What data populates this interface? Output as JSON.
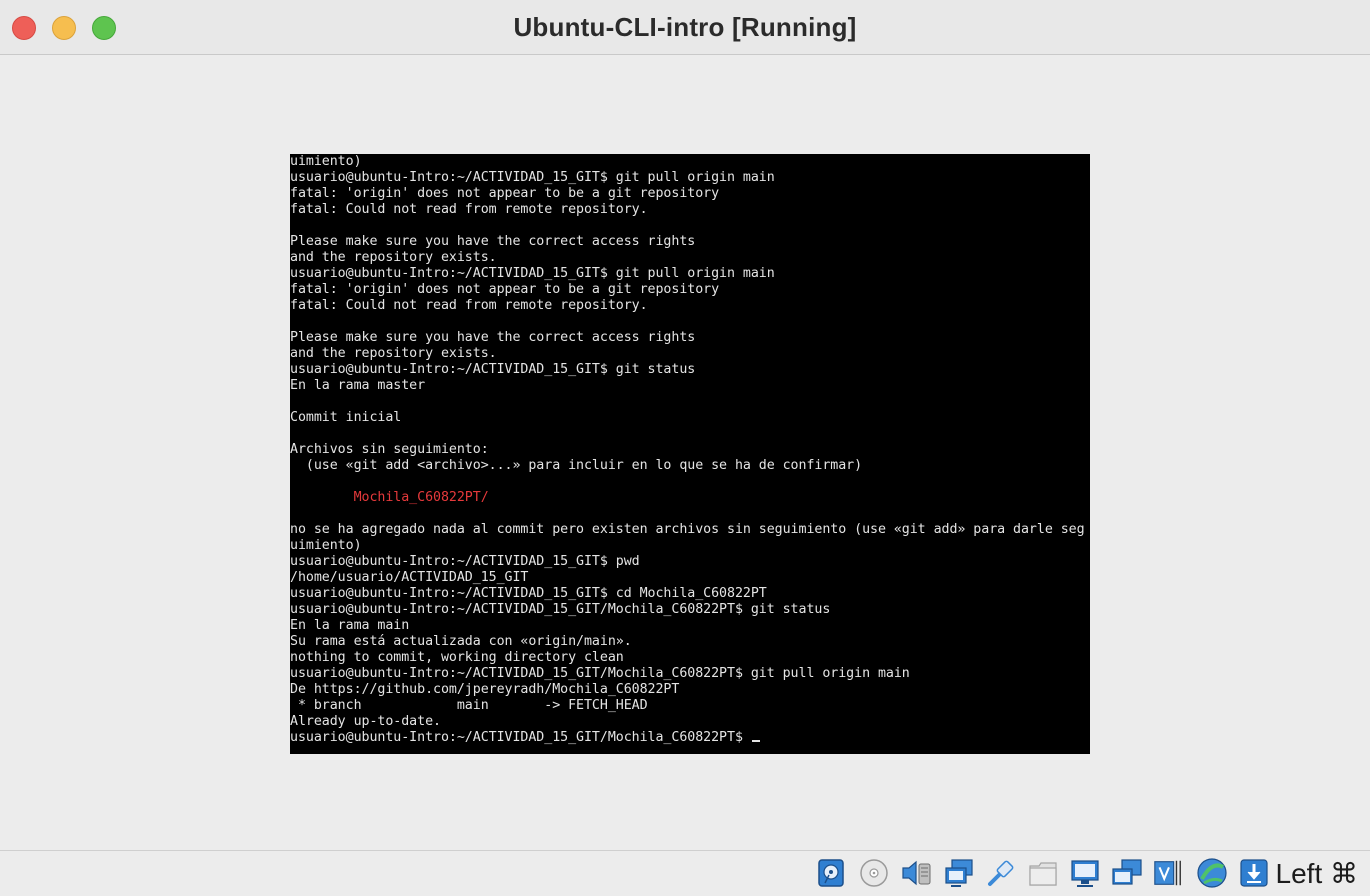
{
  "window": {
    "title": "Ubuntu-CLI-intro [Running]"
  },
  "terminal": {
    "lines": [
      {
        "text": "uimiento)",
        "color": "default"
      },
      {
        "text": "usuario@ubuntu-Intro:~/ACTIVIDAD_15_GIT$ git pull origin main",
        "color": "default"
      },
      {
        "text": "fatal: 'origin' does not appear to be a git repository",
        "color": "default"
      },
      {
        "text": "fatal: Could not read from remote repository.",
        "color": "default"
      },
      {
        "text": "",
        "color": "default"
      },
      {
        "text": "Please make sure you have the correct access rights",
        "color": "default"
      },
      {
        "text": "and the repository exists.",
        "color": "default"
      },
      {
        "text": "usuario@ubuntu-Intro:~/ACTIVIDAD_15_GIT$ git pull origin main",
        "color": "default"
      },
      {
        "text": "fatal: 'origin' does not appear to be a git repository",
        "color": "default"
      },
      {
        "text": "fatal: Could not read from remote repository.",
        "color": "default"
      },
      {
        "text": "",
        "color": "default"
      },
      {
        "text": "Please make sure you have the correct access rights",
        "color": "default"
      },
      {
        "text": "and the repository exists.",
        "color": "default"
      },
      {
        "text": "usuario@ubuntu-Intro:~/ACTIVIDAD_15_GIT$ git status",
        "color": "default"
      },
      {
        "text": "En la rama master",
        "color": "default"
      },
      {
        "text": "",
        "color": "default"
      },
      {
        "text": "Commit inicial",
        "color": "default"
      },
      {
        "text": "",
        "color": "default"
      },
      {
        "text": "Archivos sin seguimiento:",
        "color": "default"
      },
      {
        "text": "  (use «git add <archivo>...» para incluir en lo que se ha de confirmar)",
        "color": "default"
      },
      {
        "text": "",
        "color": "default"
      },
      {
        "text": "        Mochila_C60822PT/",
        "color": "red"
      },
      {
        "text": "",
        "color": "default"
      },
      {
        "text": "no se ha agregado nada al commit pero existen archivos sin seguimiento (use «git add» para darle seg",
        "color": "default"
      },
      {
        "text": "uimiento)",
        "color": "default"
      },
      {
        "text": "usuario@ubuntu-Intro:~/ACTIVIDAD_15_GIT$ pwd",
        "color": "default"
      },
      {
        "text": "/home/usuario/ACTIVIDAD_15_GIT",
        "color": "default"
      },
      {
        "text": "usuario@ubuntu-Intro:~/ACTIVIDAD_15_GIT$ cd Mochila_C60822PT",
        "color": "default"
      },
      {
        "text": "usuario@ubuntu-Intro:~/ACTIVIDAD_15_GIT/Mochila_C60822PT$ git status",
        "color": "default"
      },
      {
        "text": "En la rama main",
        "color": "default"
      },
      {
        "text": "Su rama está actualizada con «origin/main».",
        "color": "default"
      },
      {
        "text": "nothing to commit, working directory clean",
        "color": "default"
      },
      {
        "text": "usuario@ubuntu-Intro:~/ACTIVIDAD_15_GIT/Mochila_C60822PT$ git pull origin main",
        "color": "default"
      },
      {
        "text": "De https://github.com/jpereyradh/Mochila_C60822PT",
        "color": "default"
      },
      {
        "text": " * branch            main       -> FETCH_HEAD",
        "color": "default"
      },
      {
        "text": "Already up-to-date.",
        "color": "default"
      }
    ],
    "prompt": "usuario@ubuntu-Intro:~/ACTIVIDAD_15_GIT/Mochila_C60822PT$ ",
    "colors": {
      "background": "#000000",
      "default": "#e4e4e4",
      "red": "#e5393b"
    }
  },
  "statusbar": {
    "icons": [
      "hard-disk-icon",
      "optical-drive-icon",
      "audio-icon",
      "network-icon",
      "usb-icon",
      "shared-folder-icon",
      "display-icon",
      "screen-capture-icon",
      "video-recording-icon",
      "cpu-activity-icon",
      "mouse-integration-icon"
    ],
    "host_key": "Left ⌘"
  }
}
